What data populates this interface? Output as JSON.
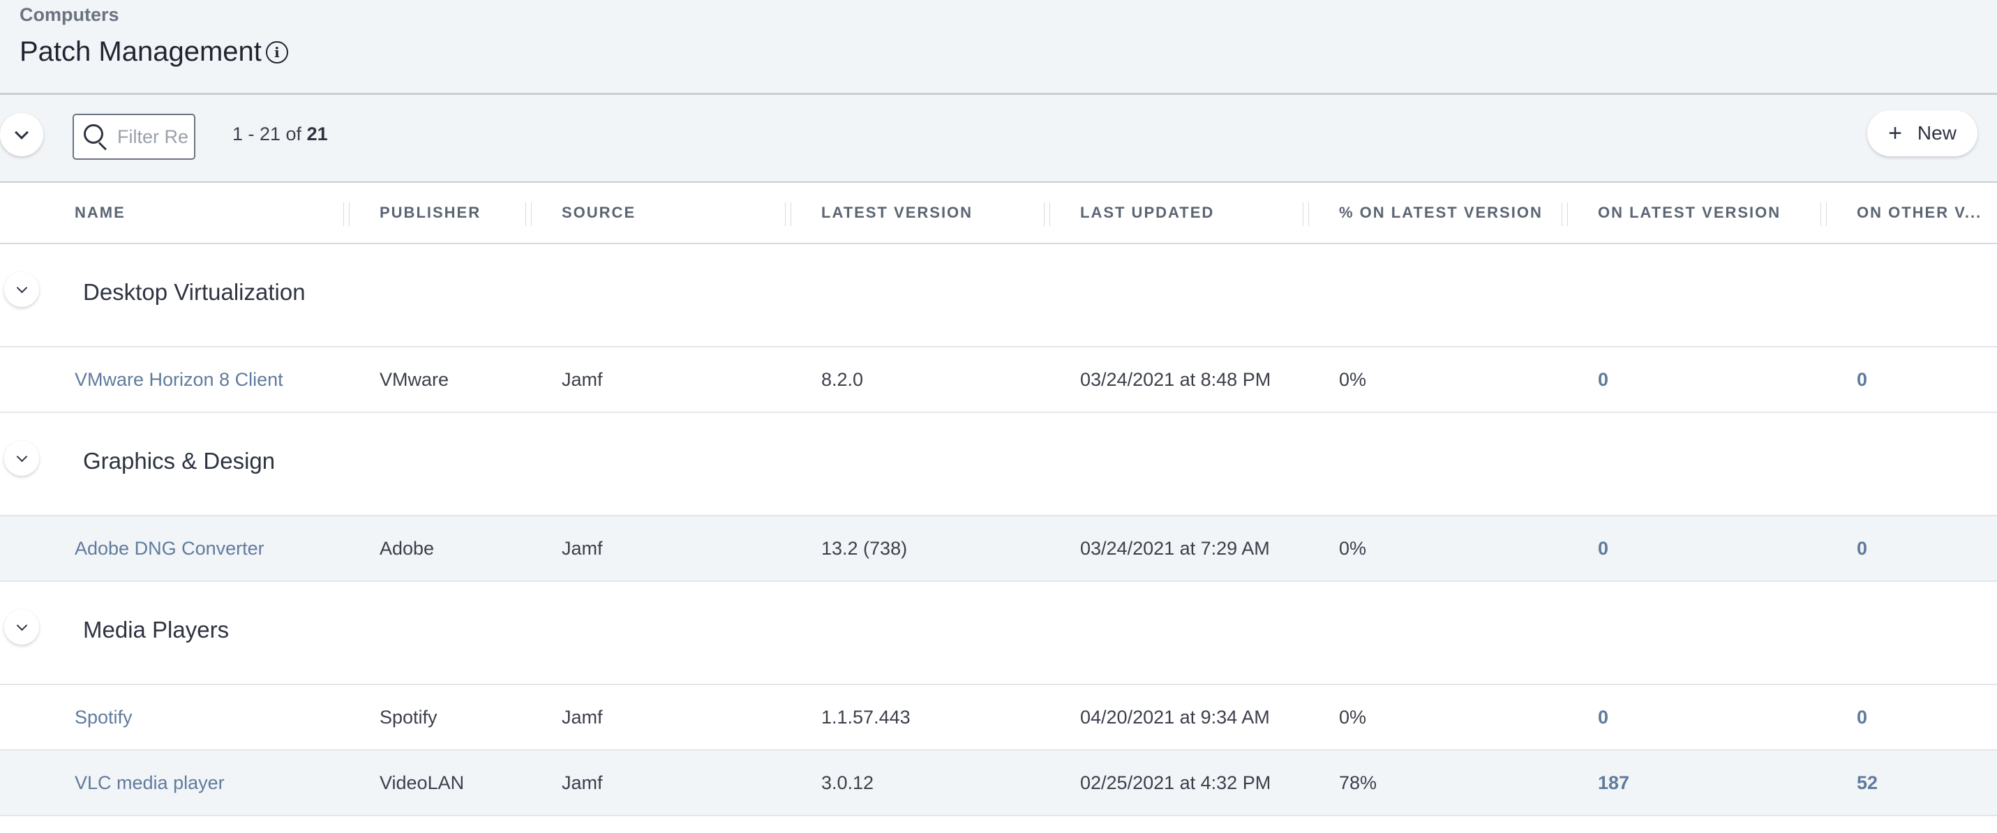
{
  "header": {
    "breadcrumb": "Computers",
    "title": "Patch Management"
  },
  "toolbar": {
    "search_placeholder": "Filter Re",
    "count_range": "1 - 21 of ",
    "count_total": "21",
    "new_label": "New"
  },
  "columns": [
    "NAME",
    "PUBLISHER",
    "SOURCE",
    "LATEST VERSION",
    "LAST UPDATED",
    "% ON LATEST VERSION",
    "ON LATEST VERSION",
    "ON OTHER V..."
  ],
  "groups": [
    {
      "name": "Desktop Virtualization",
      "rows": [
        {
          "name": "VMware Horizon 8 Client",
          "publisher": "VMware",
          "source": "Jamf",
          "latest_version": "8.2.0",
          "last_updated": "03/24/2021 at 8:48 PM",
          "pct_latest": "0%",
          "on_latest": "0",
          "on_other": "0"
        }
      ]
    },
    {
      "name": "Graphics & Design",
      "rows": [
        {
          "name": "Adobe DNG Converter",
          "publisher": "Adobe",
          "source": "Jamf",
          "latest_version": "13.2 (738)",
          "last_updated": "03/24/2021 at 7:29 AM",
          "pct_latest": "0%",
          "on_latest": "0",
          "on_other": "0"
        }
      ]
    },
    {
      "name": "Media Players",
      "rows": [
        {
          "name": "Spotify",
          "publisher": "Spotify",
          "source": "Jamf",
          "latest_version": "1.1.57.443",
          "last_updated": "04/20/2021 at 9:34 AM",
          "pct_latest": "0%",
          "on_latest": "0",
          "on_other": "0"
        },
        {
          "name": "VLC media player",
          "publisher": "VideoLAN",
          "source": "Jamf",
          "latest_version": "3.0.12",
          "last_updated": "02/25/2021 at 4:32 PM",
          "pct_latest": "78%",
          "on_latest": "187",
          "on_other": "52"
        }
      ]
    }
  ]
}
